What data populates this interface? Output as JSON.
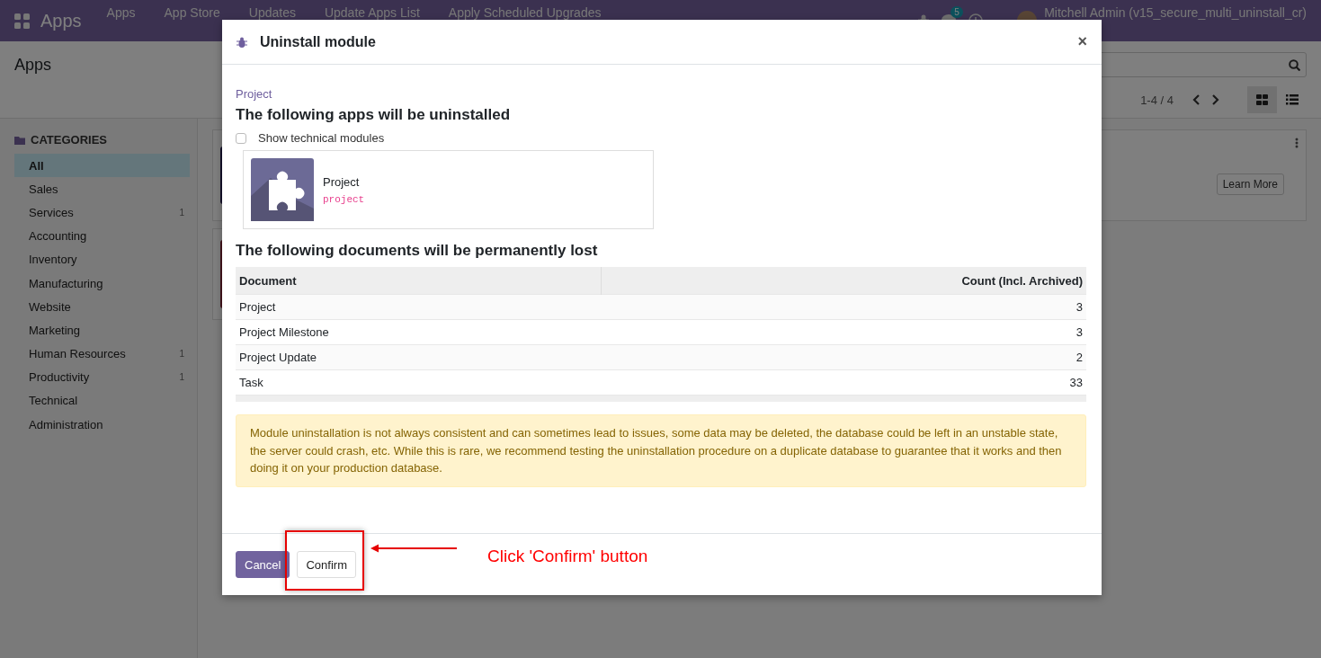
{
  "navbar": {
    "brand": "Apps",
    "menu": [
      "Apps",
      "App Store",
      "Updates",
      "Update Apps List",
      "Apply Scheduled Upgrades"
    ],
    "messages_badge": "5",
    "user": "Mitchell Admin (v15_secure_multi_uninstall_cr)"
  },
  "control_panel": {
    "breadcrumb": "Apps",
    "pager": "1-4 / 4",
    "views": [
      {
        "kind": "kanban",
        "selected": true
      },
      {
        "kind": "list",
        "selected": false
      }
    ]
  },
  "sidebar": {
    "heading": "CATEGORIES",
    "items": [
      {
        "label": "All",
        "selected": true
      },
      {
        "label": "Sales",
        "selected": false
      },
      {
        "label": "Services",
        "count": "1",
        "selected": false
      },
      {
        "label": "Accounting",
        "selected": false
      },
      {
        "label": "Inventory",
        "selected": false
      },
      {
        "label": "Manufacturing",
        "selected": false
      },
      {
        "label": "Website",
        "selected": false
      },
      {
        "label": "Marketing",
        "selected": false
      },
      {
        "label": "Human Resources",
        "count": "1",
        "selected": false
      },
      {
        "label": "Productivity",
        "count": "1",
        "selected": false
      },
      {
        "label": "Technical",
        "selected": false
      },
      {
        "label": "Administration",
        "selected": false
      }
    ]
  },
  "app_card": {
    "button": "Learn More"
  },
  "dialog": {
    "title": "Uninstall module",
    "close": "×",
    "module_label": "Project",
    "apps_heading": "The following apps will be uninstalled",
    "show_technical": {
      "label": "Show technical modules",
      "checked": false
    },
    "apps": [
      {
        "name": "Project",
        "technical_name": "project"
      }
    ],
    "documents_heading": "The following documents will be permanently lost",
    "table": {
      "columns": [
        "Document",
        "Count (Incl. Archived)"
      ],
      "rows": [
        [
          "Project",
          "3"
        ],
        [
          "Project Milestone",
          "3"
        ],
        [
          "Project Update",
          "2"
        ],
        [
          "Task",
          "33"
        ]
      ]
    },
    "warning": "Module uninstallation is not always consistent and can sometimes lead to issues, some data may be deleted, the database could be left in an unstable state, the server could crash, etc. While this is rare, we recommend testing the uninstallation procedure on a duplicate database to guarantee that it works and then doing it on your production database.",
    "buttons": [
      {
        "label": "Cancel",
        "kind": "primary"
      },
      {
        "label": "Confirm",
        "kind": "secondary"
      }
    ]
  },
  "annotation": {
    "text": "Click 'Confirm' button"
  }
}
